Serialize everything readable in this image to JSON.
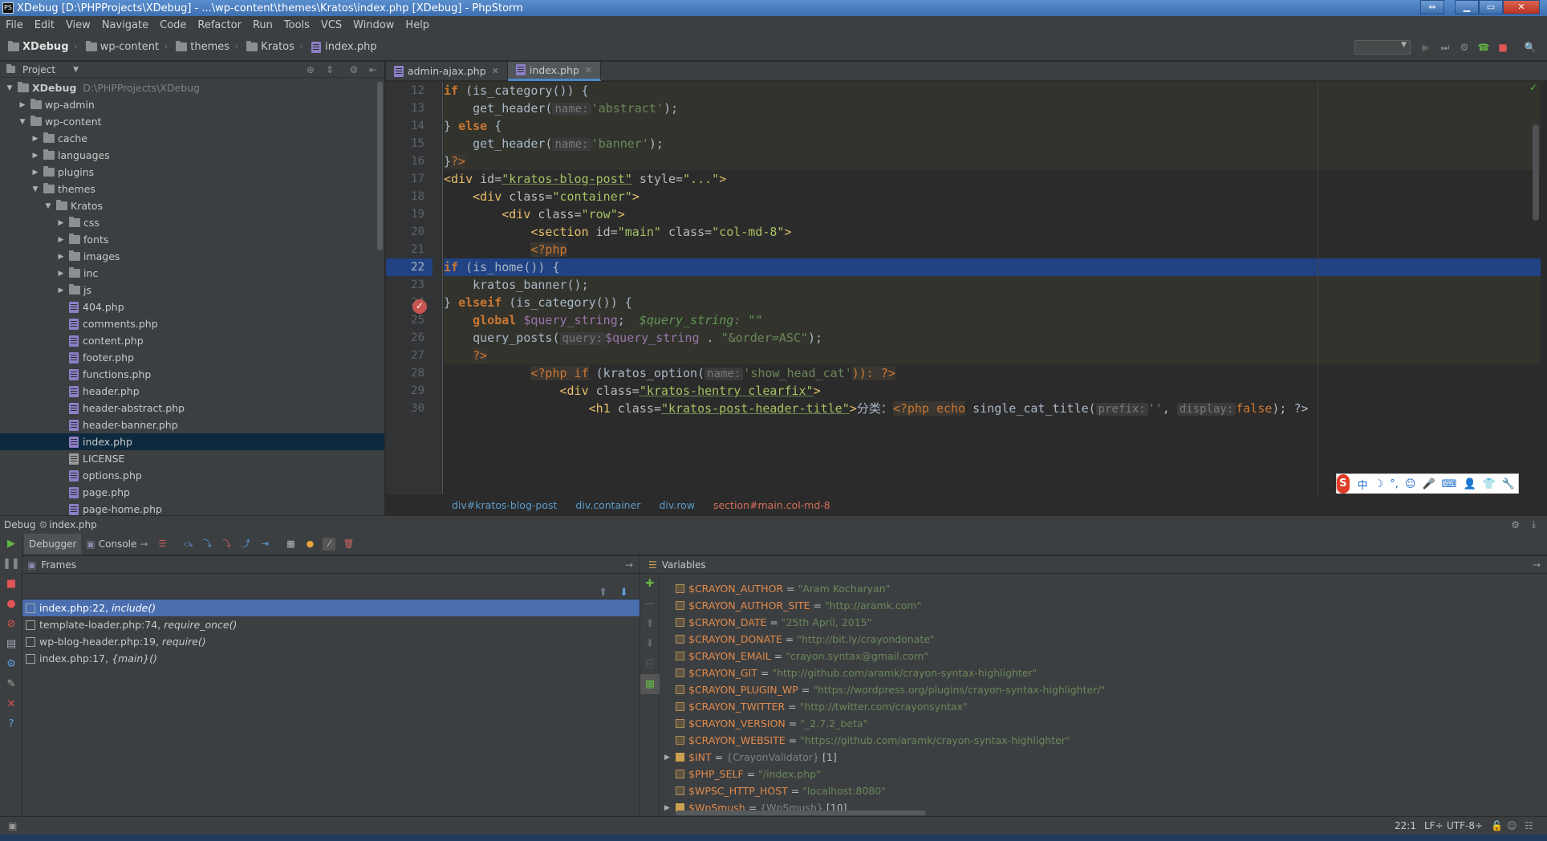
{
  "window": {
    "title": "XDebug [D:\\PHPProjects\\XDebug] - ...\\wp-content\\themes\\Kratos\\index.php [XDebug] - PhpStorm",
    "app_icon": "PS"
  },
  "menu": [
    "File",
    "Edit",
    "View",
    "Navigate",
    "Code",
    "Refactor",
    "Run",
    "Tools",
    "VCS",
    "Window",
    "Help"
  ],
  "navbar": {
    "crumbs": [
      "XDebug",
      "wp-content",
      "themes",
      "Kratos",
      "index.php"
    ]
  },
  "project_panel": {
    "title": "Project",
    "tree": [
      {
        "label": "XDebug",
        "path": "D:\\PHPProjects\\XDebug",
        "indent": 0,
        "type": "folder",
        "open": true
      },
      {
        "label": "wp-admin",
        "indent": 1,
        "type": "folder",
        "open": false
      },
      {
        "label": "wp-content",
        "indent": 1,
        "type": "folder",
        "open": true
      },
      {
        "label": "cache",
        "indent": 2,
        "type": "folder",
        "open": false
      },
      {
        "label": "languages",
        "indent": 2,
        "type": "folder",
        "open": false
      },
      {
        "label": "plugins",
        "indent": 2,
        "type": "folder",
        "open": false
      },
      {
        "label": "themes",
        "indent": 2,
        "type": "folder",
        "open": true
      },
      {
        "label": "Kratos",
        "indent": 3,
        "type": "folder",
        "open": true
      },
      {
        "label": "css",
        "indent": 4,
        "type": "folder",
        "open": false
      },
      {
        "label": "fonts",
        "indent": 4,
        "type": "folder",
        "open": false
      },
      {
        "label": "images",
        "indent": 4,
        "type": "folder",
        "open": false
      },
      {
        "label": "inc",
        "indent": 4,
        "type": "folder",
        "open": false
      },
      {
        "label": "js",
        "indent": 4,
        "type": "folder",
        "open": false
      },
      {
        "label": "404.php",
        "indent": 4,
        "type": "php"
      },
      {
        "label": "comments.php",
        "indent": 4,
        "type": "php"
      },
      {
        "label": "content.php",
        "indent": 4,
        "type": "php"
      },
      {
        "label": "footer.php",
        "indent": 4,
        "type": "php"
      },
      {
        "label": "functions.php",
        "indent": 4,
        "type": "php"
      },
      {
        "label": "header.php",
        "indent": 4,
        "type": "php"
      },
      {
        "label": "header-abstract.php",
        "indent": 4,
        "type": "php"
      },
      {
        "label": "header-banner.php",
        "indent": 4,
        "type": "php"
      },
      {
        "label": "index.php",
        "indent": 4,
        "type": "php",
        "selected": true
      },
      {
        "label": "LICENSE",
        "indent": 4,
        "type": "file"
      },
      {
        "label": "options.php",
        "indent": 4,
        "type": "php"
      },
      {
        "label": "page.php",
        "indent": 4,
        "type": "php"
      },
      {
        "label": "page-home.php",
        "indent": 4,
        "type": "php"
      }
    ]
  },
  "editor": {
    "tabs": [
      {
        "label": "admin-ajax.php",
        "active": false
      },
      {
        "label": "index.php",
        "active": true
      }
    ],
    "line_numbers": [
      "12",
      "13",
      "14",
      "15",
      "16",
      "17",
      "18",
      "19",
      "20",
      "21",
      "22",
      "23",
      "24",
      "25",
      "26",
      "27",
      "28",
      "29",
      "30"
    ],
    "breadcrumb": [
      "div#kratos-blog-post",
      "div.container",
      "div.row",
      "section#main.col-md-8"
    ],
    "text": {
      "l12_if": "if",
      "l12_rest": " (is_category()) {",
      "get_header": "get_header(",
      "hint_name": "name:",
      "abstract": "'abstract'",
      "close_semicolon": ");",
      "l14_brace": "} ",
      "else": "else",
      "else_brace": " {",
      "banner": "'banner'",
      "l16_brace": "}",
      "php_close": "?>",
      "div_open": "<div",
      "id_attr": " id=",
      "kbp": "\"kratos-blog-post\"",
      "style_attr": " style=",
      "style_val": "\"...\"",
      "gt": ">",
      "class_attr": " class=",
      "container": "\"container\"",
      "row": "\"row\"",
      "section_open": "<section",
      "main": "\"main\"",
      "colmd8": "\"col-md-8\"",
      "php_open": "<?php",
      "is_home": " (is_home()) {",
      "kratos_banner": "kratos_banner();",
      "l24_brace": "} ",
      "elseif": "elseif",
      "elseif_rest": " (is_category()) {",
      "global": "global",
      "query_string_var": " $query_string",
      "semicolon": ";",
      "inline_value": "$query_string: \"\"",
      "query_posts": "query_posts(",
      "hint_query": "query:",
      "qs": "$query_string",
      "dot": " . ",
      "order": "\"&order=ASC\"",
      "php_open_if": "<?php if",
      "kratos_option": " (kratos_option(",
      "show_head_cat": "'show_head_cat'",
      "close_paren_colon": ")): ?>",
      "hentry": "\"kratos-hentry clearfix\"",
      "h1_open": "<h1",
      "post_header_title": "\"kratos-post-header-title\"",
      "cat_label": "分类：",
      "php_echo": "<?php echo",
      "single_cat_title": " single_cat_title(",
      "hint_prefix": "prefix:",
      "empty_str": "''",
      "comma": ", ",
      "hint_display": "display:",
      "false": "false",
      "close_end": "); ?>"
    }
  },
  "ime_bar": {
    "logo": "S",
    "items": [
      "中",
      "☽",
      "°,",
      "☺",
      "🎤",
      "⌨",
      "👤",
      "👕",
      "🔧"
    ]
  },
  "debug": {
    "title": "Debug",
    "config": "index.php",
    "tabs": [
      {
        "label": "Debugger",
        "active": true
      },
      {
        "label": "Console",
        "active": false
      }
    ],
    "frames_title": "Frames",
    "frames": [
      {
        "file": "index.php:22,",
        "func": "include()",
        "selected": true
      },
      {
        "file": "template-loader.php:74,",
        "func": "require_once()",
        "selected": false
      },
      {
        "file": "wp-blog-header.php:19,",
        "func": "require()",
        "selected": false
      },
      {
        "file": "index.php:17,",
        "func": "{main}()",
        "selected": false
      }
    ],
    "variables_title": "Variables",
    "variables": [
      {
        "name": "$CRAYON_AUTHOR",
        "value": "\"Aram Kocharyan\"",
        "kind": "string"
      },
      {
        "name": "$CRAYON_AUTHOR_SITE",
        "value": "\"http://aramk.com\"",
        "kind": "string"
      },
      {
        "name": "$CRAYON_DATE",
        "value": "\"25th April, 2015\"",
        "kind": "string"
      },
      {
        "name": "$CRAYON_DONATE",
        "value": "\"http://bit.ly/crayondonate\"",
        "kind": "string"
      },
      {
        "name": "$CRAYON_EMAIL",
        "value": "\"crayon.syntax@gmail.com\"",
        "kind": "string"
      },
      {
        "name": "$CRAYON_GIT",
        "value": "\"http://github.com/aramk/crayon-syntax-highlighter\"",
        "kind": "string"
      },
      {
        "name": "$CRAYON_PLUGIN_WP",
        "value": "\"https://wordpress.org/plugins/crayon-syntax-highlighter/\"",
        "kind": "string"
      },
      {
        "name": "$CRAYON_TWITTER",
        "value": "\"http://twitter.com/crayonsyntax\"",
        "kind": "string"
      },
      {
        "name": "$CRAYON_VERSION",
        "value": "\"_2.7.2_beta\"",
        "kind": "string"
      },
      {
        "name": "$CRAYON_WEBSITE",
        "value": "\"https://github.com/aramk/crayon-syntax-highlighter\"",
        "kind": "string"
      },
      {
        "name": "$INT",
        "value": "{CrayonValidator}",
        "count": "[1]",
        "kind": "object"
      },
      {
        "name": "$PHP_SELF",
        "value": "\"/index.php\"",
        "kind": "string"
      },
      {
        "name": "$WPSC_HTTP_HOST",
        "value": "\"localhost:8080\"",
        "kind": "string"
      },
      {
        "name": "$WpSmush",
        "value": "{WpSmush}",
        "count": "[10]",
        "kind": "object"
      }
    ]
  },
  "status": {
    "position": "22:1",
    "line_sep": "LF÷",
    "encoding": "UTF-8÷"
  },
  "colors": {
    "accent": "#4b6eaf",
    "breakpoint": "#c75450",
    "exec_line": "#214283"
  }
}
